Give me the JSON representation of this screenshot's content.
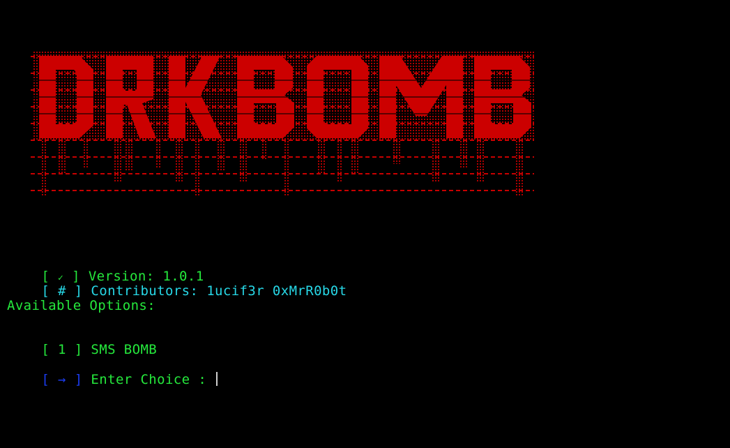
{
  "banner": {
    "text": "DRKBOMB",
    "color": "#cc0000",
    "accent_color": "#a00000"
  },
  "lines": {
    "version": {
      "bracket_open": "[",
      "symbol": "✓",
      "bracket_close": "]",
      "label": "Version:",
      "value": "1.0.1"
    },
    "contributors": {
      "bracket_open": "[",
      "symbol": "#",
      "bracket_close": "]",
      "label": "Contributors:",
      "names": "1ucif3r 0xMrR0b0t"
    },
    "options_heading": "Available Options:",
    "option_1": {
      "bracket_open": "[",
      "number": "1",
      "bracket_close": "]",
      "label": "SMS BOMB"
    },
    "prompt": {
      "bracket_open": "[",
      "symbol": "→",
      "bracket_close": "]",
      "label": "Enter Choice :",
      "value": ""
    }
  },
  "colors": {
    "background": "#000000",
    "green": "#25e83c",
    "cyan": "#27d7e6",
    "blue": "#1b3cf0",
    "banner_red": "#cc0000"
  }
}
